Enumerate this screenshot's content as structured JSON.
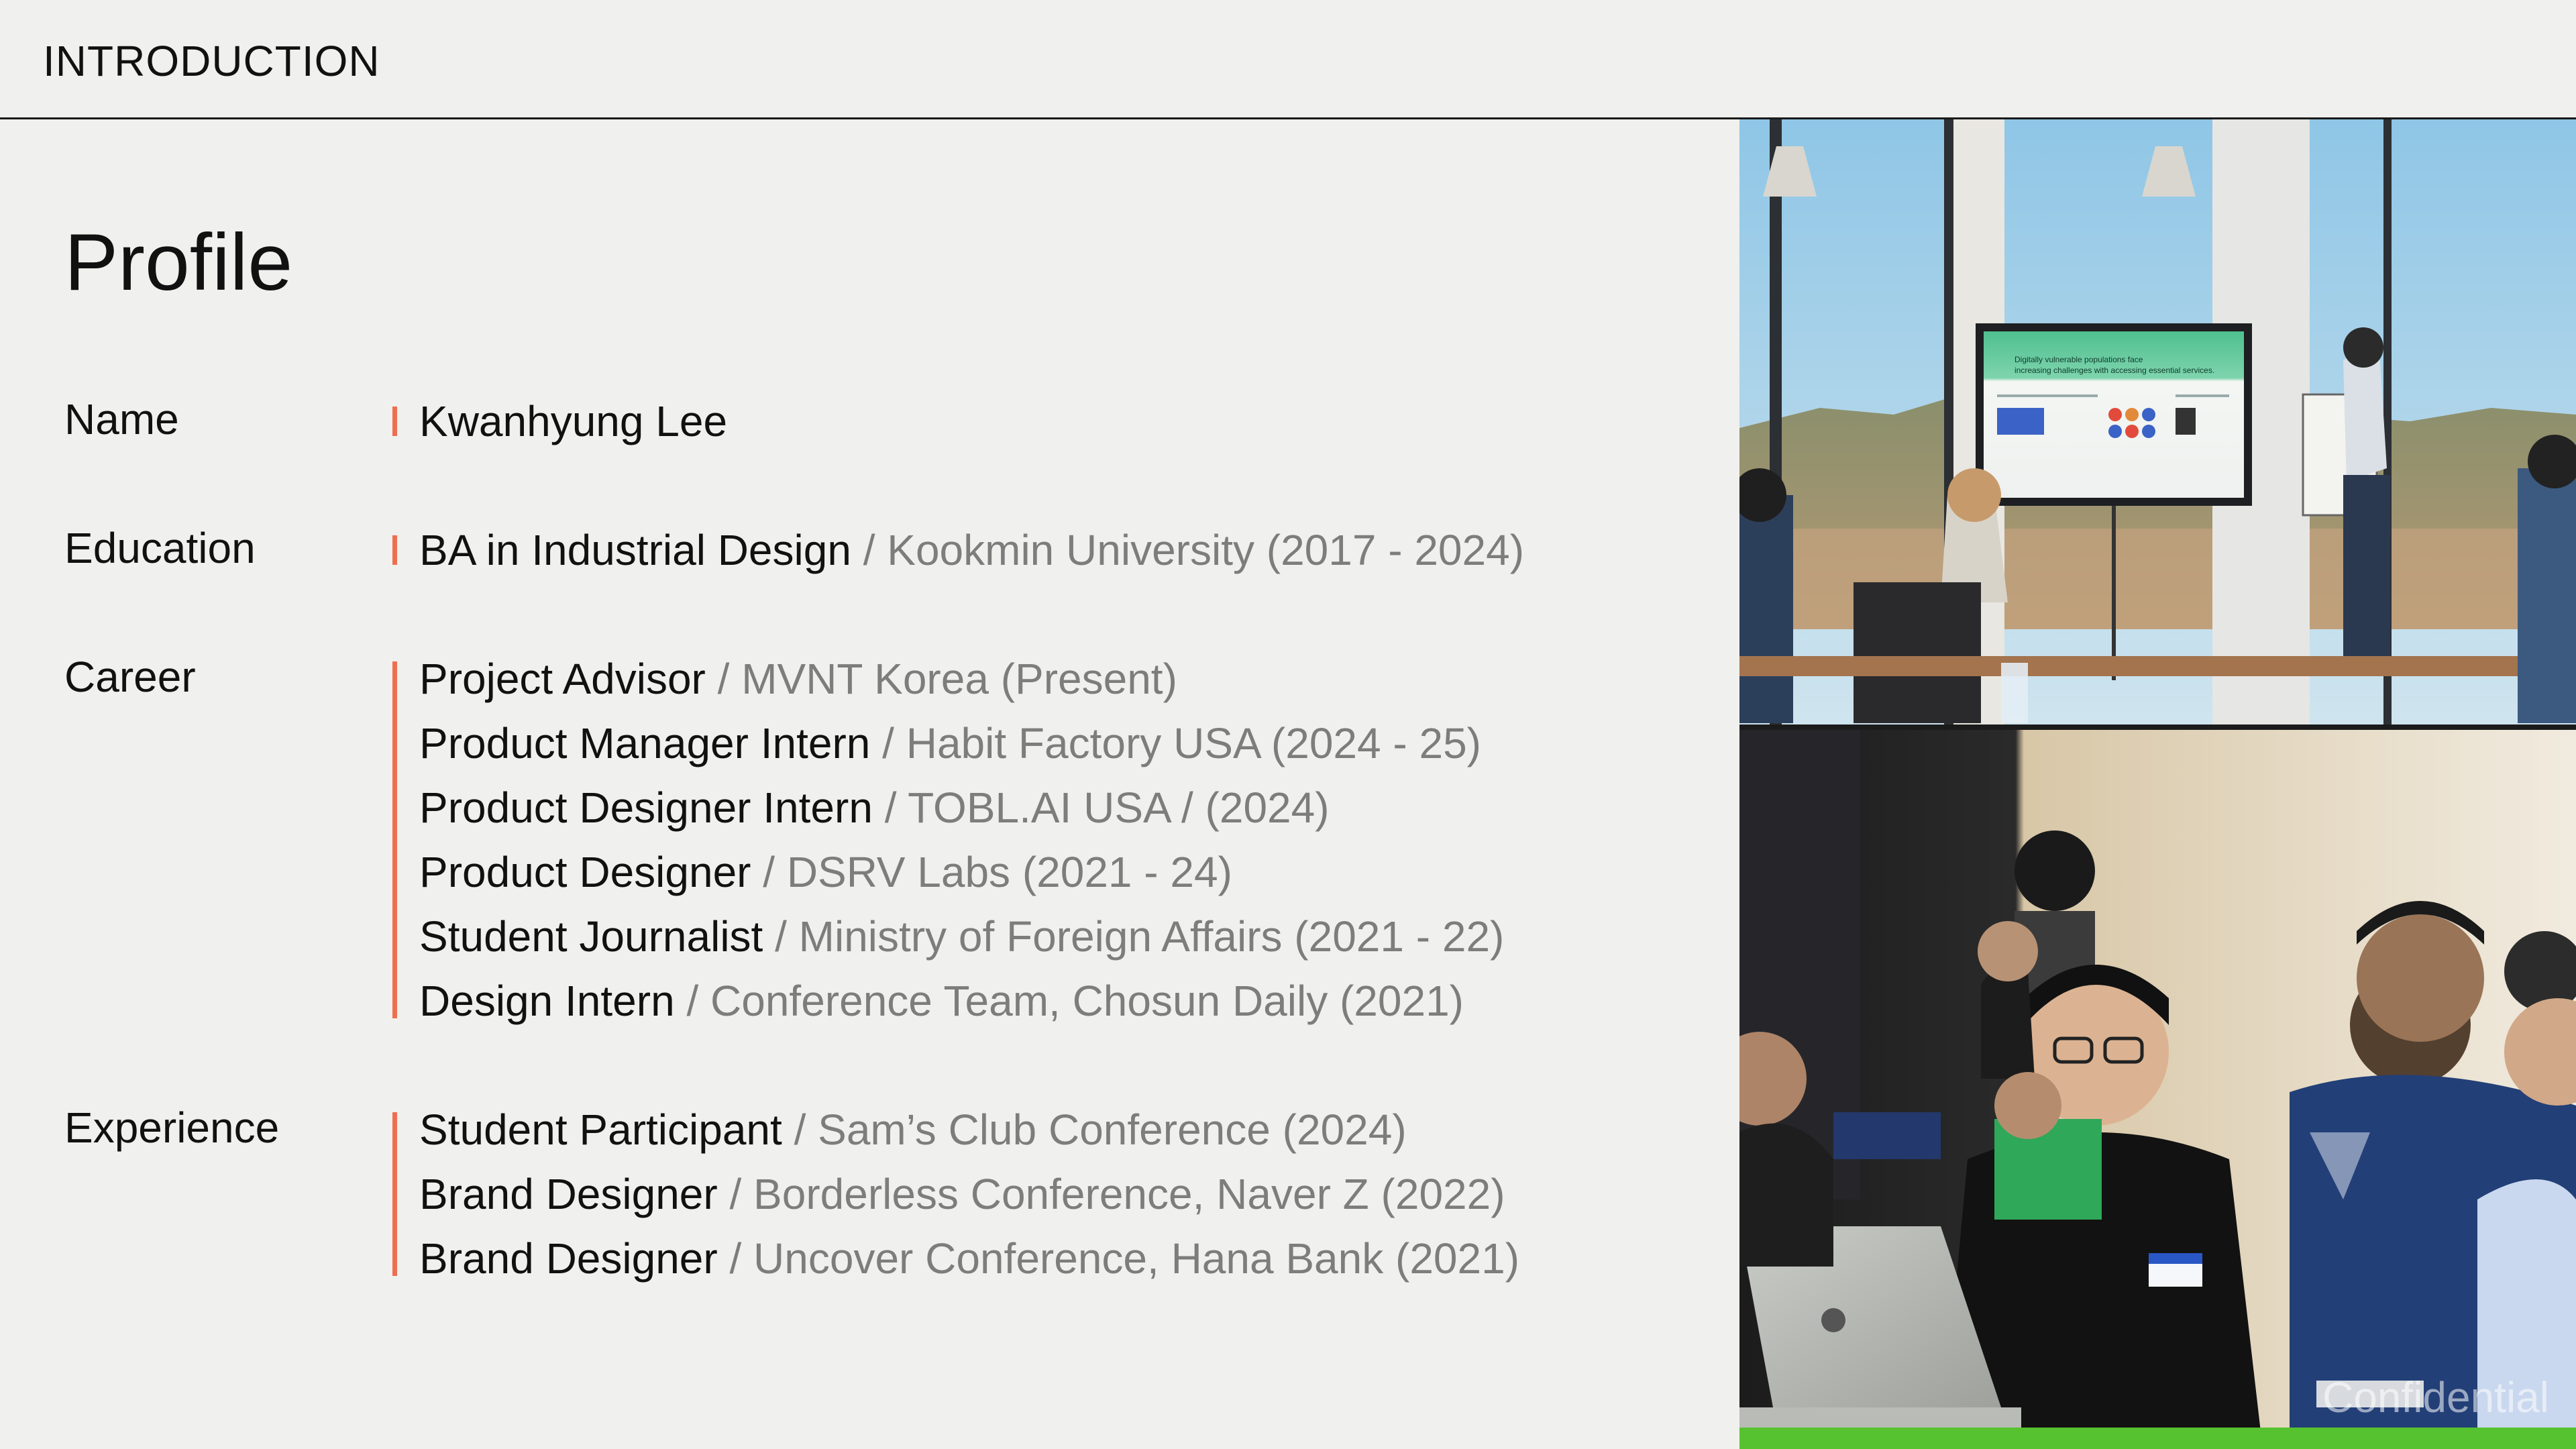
{
  "header": {
    "title": "INTRODUCTION"
  },
  "page": {
    "title": "Profile"
  },
  "profile": {
    "name": {
      "label": "Name",
      "value": "Kwanhyung Lee"
    },
    "education": {
      "label": "Education",
      "entries": [
        {
          "primary": "BA in Industrial Design",
          "secondary": " / Kookmin University (2017 - 2024)"
        }
      ]
    },
    "career": {
      "label": "Career",
      "entries": [
        {
          "primary": "Project Advisor",
          "secondary": " / MVNT Korea (Present)"
        },
        {
          "primary": "Product Manager Intern",
          "secondary": " / Habit Factory USA (2024 - 25)"
        },
        {
          "primary": "Product Designer Intern",
          "secondary": " / TOBL.AI USA /  (2024)"
        },
        {
          "primary": "Product Designer",
          "secondary": " / DSRV Labs (2021 - 24)"
        },
        {
          "primary": "Student Journalist",
          "secondary": " / Ministry of Foreign Affairs (2021 - 22)"
        },
        {
          "primary": "Design Intern",
          "secondary": " / Conference Team, Chosun Daily (2021)"
        }
      ]
    },
    "experience": {
      "label": "Experience",
      "entries": [
        {
          "primary": "Student Participant",
          "secondary": " / Sam’s Club Conference (2024)"
        },
        {
          "primary": "Brand Designer",
          "secondary": " / Borderless Conference, Naver Z (2022)"
        },
        {
          "primary": "Brand Designer",
          "secondary": " / Uncover Conference, Hana Bank (2021)"
        }
      ]
    }
  },
  "photos": {
    "slide": {
      "heading_line1": "Digitally vulnerable populations face",
      "heading_line2": "increasing challenges with accessing essential services."
    },
    "watermark": "Confidential"
  },
  "colors": {
    "accent": "#ee6f4f",
    "background": "#f0f0ee",
    "muted_text": "#7d7d7d"
  }
}
